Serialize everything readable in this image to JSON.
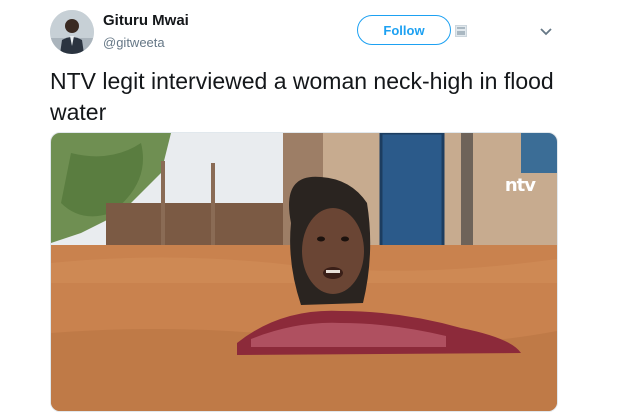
{
  "tweet": {
    "author": {
      "name": "Gituru Mwai",
      "handle": "@gitweeta"
    },
    "follow_label": "Follow",
    "text": "NTV legit interviewed a woman neck-high in flood water",
    "media": {
      "watermark": "ntv"
    }
  },
  "colors": {
    "accent": "#1da1f2",
    "floodwater": "#c9824e"
  },
  "icons": [
    "avatar",
    "card-icon",
    "chevron-down-icon"
  ]
}
